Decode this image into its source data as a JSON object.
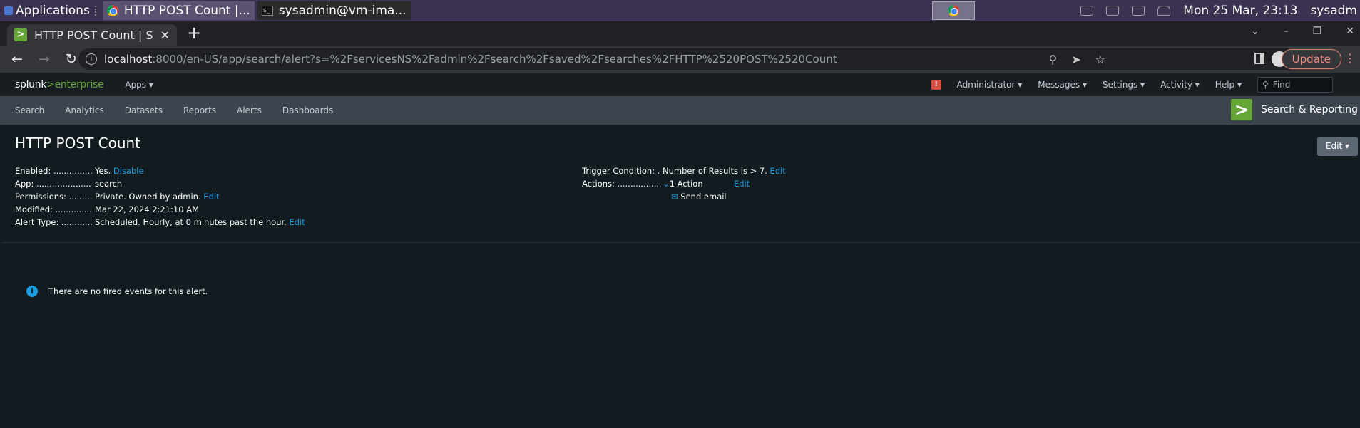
{
  "taskbar": {
    "applications": "Applications",
    "win_chrome": "HTTP POST Count |...",
    "win_terminal": "sysadmin@vm-ima...",
    "datetime": "Mon 25 Mar, 23:13",
    "user": "sysadm"
  },
  "browser": {
    "tab_title": "HTTP POST Count | Splunk",
    "url_host": "localhost",
    "url_rest": ":8000/en-US/app/search/alert?s=%2FservicesNS%2Fadmin%2Fsearch%2Fsaved%2Fsearches%2FHTTP%2520POST%2520Count",
    "update_label": "Update"
  },
  "splunk": {
    "logo_a": "splunk",
    "logo_b": ">",
    "logo_c": "enterprise",
    "apps": "Apps",
    "administrator": "Administrator",
    "messages": "Messages",
    "settings": "Settings",
    "activity": "Activity",
    "help": "Help",
    "find_placeholder": "Find",
    "nav": [
      "Search",
      "Analytics",
      "Datasets",
      "Reports",
      "Alerts",
      "Dashboards"
    ],
    "app_name": "Search & Reporting"
  },
  "alert": {
    "title": "HTTP POST Count",
    "edit": "Edit",
    "enabled_label": "Enabled: ...............................",
    "enabled_value": "Yes.",
    "disable_link": "Disable",
    "app_label": "App: .............................................",
    "app_value": "search",
    "perm_label": "Permissions: ...............................",
    "perm_value": "Private. Owned by admin.",
    "perm_edit": "Edit",
    "modified_label": "Modified: ....................................",
    "modified_value": "Mar 22, 2024 2:21:10 AM",
    "type_label": "Alert Type: ..................................",
    "type_value": "Scheduled. Hourly, at 0 minutes past the hour.",
    "type_edit": "Edit",
    "trigger_label": "Trigger Condition: ................",
    "trigger_value": "Number of Results is > 7.",
    "trigger_edit": "Edit",
    "actions_label": "Actions: ......................................",
    "actions_value": "1 Action",
    "actions_edit": "Edit",
    "action_item": "Send email",
    "no_events": "There are no fired events for this alert."
  }
}
